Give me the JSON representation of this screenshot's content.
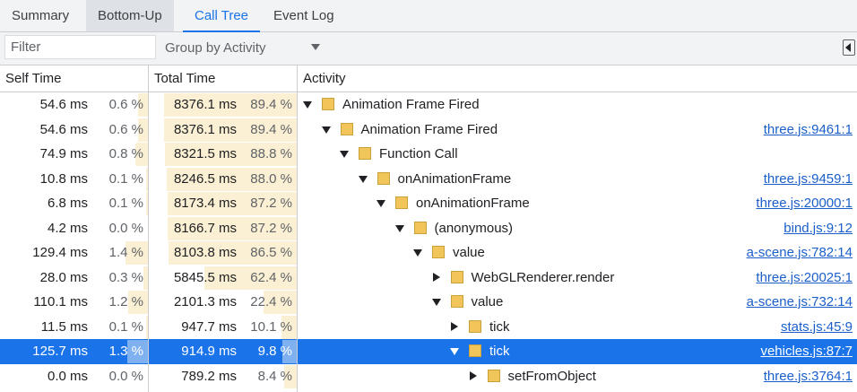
{
  "tabs": [
    {
      "label": "Summary",
      "state": "normal"
    },
    {
      "label": "Bottom-Up",
      "state": "hover"
    },
    {
      "label": "Call Tree",
      "state": "active"
    },
    {
      "label": "Event Log",
      "state": "normal"
    }
  ],
  "toolbar": {
    "filter_placeholder": "Filter",
    "group_by_label": "Group by Activity",
    "sidebar_toggle_icon": "sidebar-toggle-icon"
  },
  "columns": {
    "self_time": "Self Time",
    "total_time": "Total Time",
    "activity": "Activity"
  },
  "colors": {
    "accent": "#1a73e8",
    "selection": "#1a73e8",
    "percent_bar": "#fbf0d3",
    "activity_square": "#f2c55b",
    "link": "#1a5fc9"
  },
  "rows": [
    {
      "self": "54.6 ms",
      "self_pct": "0.6 %",
      "self_frac": 0.006,
      "total": "8376.1 ms",
      "total_pct": "89.4 %",
      "total_frac": 0.894,
      "depth": 0,
      "expand": "down",
      "name": "Animation Frame Fired",
      "source": "",
      "selected": false
    },
    {
      "self": "54.6 ms",
      "self_pct": "0.6 %",
      "self_frac": 0.006,
      "total": "8376.1 ms",
      "total_pct": "89.4 %",
      "total_frac": 0.894,
      "depth": 1,
      "expand": "down",
      "name": "Animation Frame Fired",
      "source": "three.js:9461:1",
      "selected": false
    },
    {
      "self": "74.9 ms",
      "self_pct": "0.8 %",
      "self_frac": 0.008,
      "total": "8321.5 ms",
      "total_pct": "88.8 %",
      "total_frac": 0.888,
      "depth": 2,
      "expand": "down",
      "name": "Function Call",
      "source": "",
      "selected": false
    },
    {
      "self": "10.8 ms",
      "self_pct": "0.1 %",
      "self_frac": 0.001,
      "total": "8246.5 ms",
      "total_pct": "88.0 %",
      "total_frac": 0.88,
      "depth": 3,
      "expand": "down",
      "name": "onAnimationFrame",
      "source": "three.js:9459:1",
      "selected": false
    },
    {
      "self": "6.8 ms",
      "self_pct": "0.1 %",
      "self_frac": 0.001,
      "total": "8173.4 ms",
      "total_pct": "87.2 %",
      "total_frac": 0.872,
      "depth": 4,
      "expand": "down",
      "name": "onAnimationFrame",
      "source": "three.js:20000:1",
      "selected": false
    },
    {
      "self": "4.2 ms",
      "self_pct": "0.0 %",
      "self_frac": 0.0,
      "total": "8166.7 ms",
      "total_pct": "87.2 %",
      "total_frac": 0.872,
      "depth": 5,
      "expand": "down",
      "name": "(anonymous)",
      "source": "bind.js:9:12",
      "selected": false
    },
    {
      "self": "129.4 ms",
      "self_pct": "1.4 %",
      "self_frac": 0.014,
      "total": "8103.8 ms",
      "total_pct": "86.5 %",
      "total_frac": 0.865,
      "depth": 6,
      "expand": "down",
      "name": "value",
      "source": "a-scene.js:782:14",
      "selected": false
    },
    {
      "self": "28.0 ms",
      "self_pct": "0.3 %",
      "self_frac": 0.003,
      "total": "5845.5 ms",
      "total_pct": "62.4 %",
      "total_frac": 0.624,
      "depth": 7,
      "expand": "right",
      "name": "WebGLRenderer.render",
      "source": "three.js:20025:1",
      "selected": false
    },
    {
      "self": "110.1 ms",
      "self_pct": "1.2 %",
      "self_frac": 0.012,
      "total": "2101.3 ms",
      "total_pct": "22.4 %",
      "total_frac": 0.224,
      "depth": 7,
      "expand": "down",
      "name": "value",
      "source": "a-scene.js:732:14",
      "selected": false
    },
    {
      "self": "11.5 ms",
      "self_pct": "0.1 %",
      "self_frac": 0.001,
      "total": "947.7 ms",
      "total_pct": "10.1 %",
      "total_frac": 0.101,
      "depth": 8,
      "expand": "right",
      "name": "tick",
      "source": "stats.js:45:9",
      "selected": false
    },
    {
      "self": "125.7 ms",
      "self_pct": "1.3 %",
      "self_frac": 0.013,
      "total": "914.9 ms",
      "total_pct": "9.8 %",
      "total_frac": 0.098,
      "depth": 8,
      "expand": "down",
      "name": "tick",
      "source": "vehicles.js:87:7",
      "selected": true
    },
    {
      "self": "0.0 ms",
      "self_pct": "0.0 %",
      "self_frac": 0.0,
      "total": "789.2 ms",
      "total_pct": "8.4 %",
      "total_frac": 0.084,
      "depth": 9,
      "expand": "right",
      "name": "setFromObject",
      "source": "three.js:3764:1",
      "selected": false
    }
  ]
}
